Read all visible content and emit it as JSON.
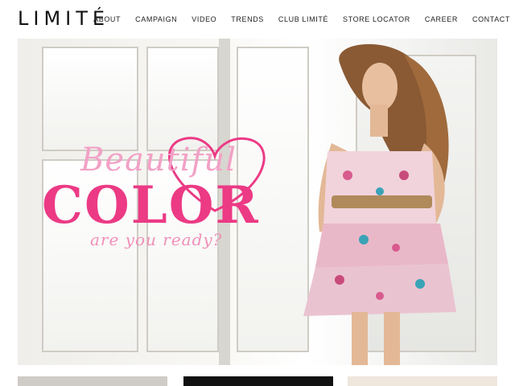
{
  "brand": {
    "logo": "LIMITÉ"
  },
  "nav": {
    "items": [
      "ABOUT",
      "CAMPAIGN",
      "VIDEO",
      "TRENDS",
      "CLUB LIMITÉ",
      "STORE LOCATOR",
      "CAREER",
      "CONTACT"
    ]
  },
  "hero": {
    "line1": "Beautiful",
    "line2": "COLOR",
    "line3": "are you ready?"
  },
  "colors": {
    "accent_pink": "#ec3a85",
    "light_pink": "#f2a1c6"
  }
}
